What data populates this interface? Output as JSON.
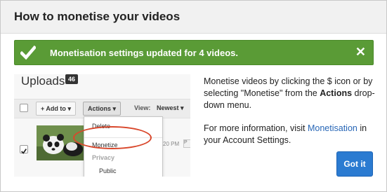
{
  "dialog": {
    "title": "How to monetise your videos"
  },
  "banner": {
    "message": "Monetisation settings updated for 4 videos.",
    "check_icon": "checkmark-icon",
    "close_glyph": "✕",
    "color": "#5a9b36"
  },
  "screenshot": {
    "uploads_title": "Uploads",
    "uploads_count": "46",
    "add_to_label": "+ Add to",
    "actions_label": "Actions",
    "view_label": "View:",
    "sort_label": "Newest",
    "row_time": "20 PM",
    "row_tag": "P",
    "menu": {
      "delete": "Delete",
      "monetize": "Monetize",
      "privacy": "Privacy",
      "public": "Public"
    },
    "highlight_color": "#d9472b"
  },
  "info": {
    "line1_prefix": "Monetise videos by clicking the $ icon or by selecting \"Monetise\" from the ",
    "line1_strong": "Actions",
    "line1_suffix": " drop-down menu.",
    "line2_prefix": "For more information, visit ",
    "line2_link": "Monetisation",
    "line2_suffix": " in your Account Settings.",
    "link_color": "#2766b6"
  },
  "button": {
    "got_it": "Got it",
    "color": "#2b7bd1"
  }
}
